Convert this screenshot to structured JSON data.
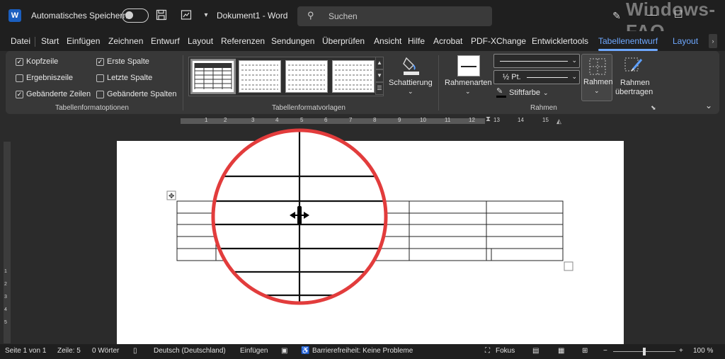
{
  "titlebar": {
    "autosave_label": "Automatisches Speichern",
    "doc_title": "Dokument1 - Word",
    "search_placeholder": "Suchen",
    "watermark": "Windows-FAQ",
    "icons": [
      "word-logo-icon",
      "save-icon",
      "touch-mode-icon",
      "customize-qat-icon",
      "search-icon",
      "pen-icon",
      "minimize-icon",
      "maximize-icon"
    ]
  },
  "tabs": [
    "Datei",
    "Start",
    "Einfügen",
    "Zeichnen",
    "Entwurf",
    "Layout",
    "Referenzen",
    "Sendungen",
    "Überprüfen",
    "Ansicht",
    "Hilfe",
    "Acrobat",
    "PDF-XChange",
    "Entwicklertools",
    "Tabellenentwurf",
    "Layout"
  ],
  "active_tab": "Tabellenentwurf",
  "ribbon": {
    "options": {
      "items": [
        {
          "label": "Kopfzeile",
          "checked": true
        },
        {
          "label": "Ergebniszeile",
          "checked": false
        },
        {
          "label": "Gebänderte Zeilen",
          "checked": true
        },
        {
          "label": "Erste Spalte",
          "checked": true
        },
        {
          "label": "Letzte Spalte",
          "checked": false
        },
        {
          "label": "Gebänderte Spalten",
          "checked": false
        }
      ],
      "group_label": "Tabellenformatoptionen"
    },
    "styles": {
      "group_label": "Tabellenformatvorlagen"
    },
    "shading": {
      "label": "Schattierung"
    },
    "borders": {
      "border_styles_label": "Rahmenarten",
      "weight_value": "½ Pt.",
      "pen_color_label": "Stiftfarbe",
      "borders_label": "Rahmen",
      "painter_label_1": "Rahmen",
      "painter_label_2": "übertragen",
      "group_label": "Rahmen"
    }
  },
  "ruler": {
    "numbers": [
      "1",
      "2",
      "3",
      "4",
      "5",
      "6",
      "7",
      "8",
      "9",
      "10",
      "11",
      "12",
      "13",
      "14",
      "15"
    ],
    "vnumbers": [
      "1",
      "2",
      "3",
      "4",
      "5"
    ]
  },
  "statusbar": {
    "page": "Seite 1 von 1",
    "line": "Zeile: 5",
    "words": "0 Wörter",
    "language": "Deutsch (Deutschland)",
    "mode": "Einfügen",
    "accessibility": "Barrierefreiheit: Keine Probleme",
    "focus": "Fokus",
    "zoom_minus": "−",
    "zoom_plus": "+",
    "zoom": "100 %"
  },
  "colors": {
    "accent": "#6ea8ff",
    "magnifier_ring": "#e23c3c",
    "background": "#2b2b2b"
  }
}
